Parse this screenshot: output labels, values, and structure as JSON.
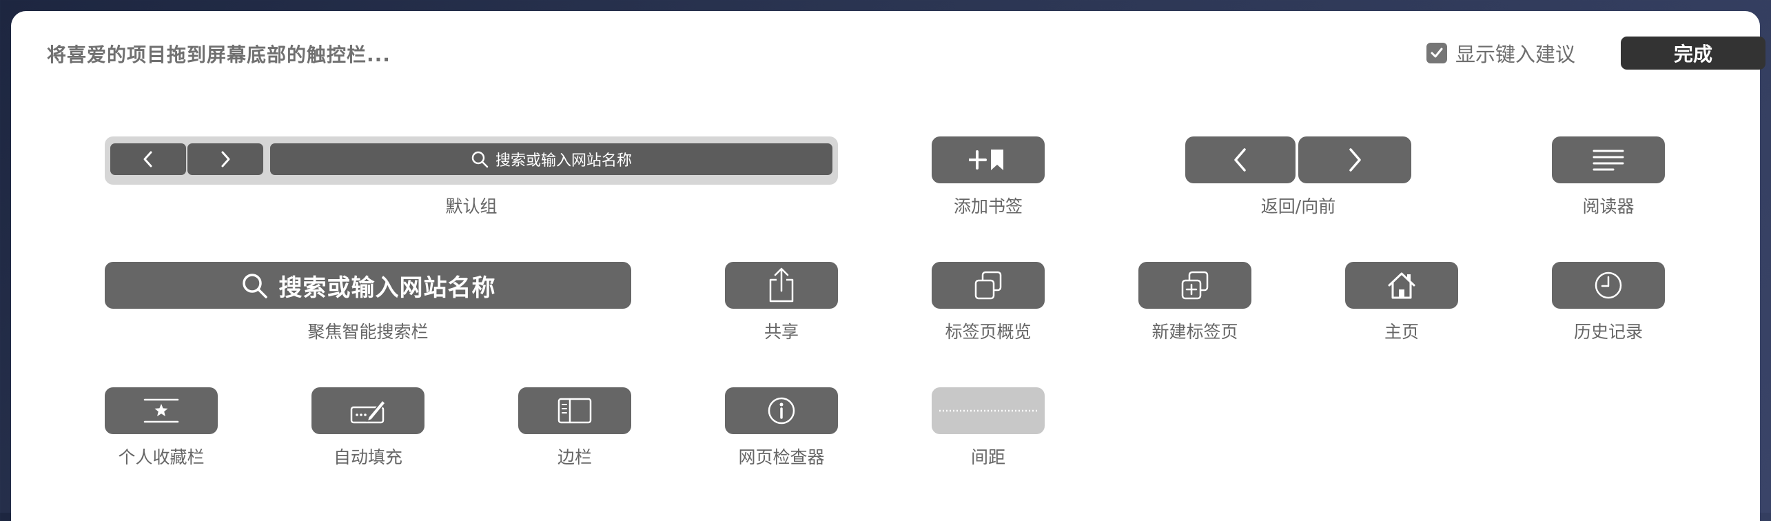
{
  "header": {
    "instruction": "将喜爱的项目拖到屏幕底部的触控栏...",
    "suggest_label": "显示键入建议",
    "suggest_checked": true,
    "done_label": "完成"
  },
  "items": {
    "default_group": {
      "label": "默认组",
      "search_text": "搜索或输入网站名称"
    },
    "add_bookmark": {
      "label": "添加书签",
      "icon": "add-bookmark-icon"
    },
    "back_forward": {
      "label": "返回/向前",
      "icon": "chevron-icon"
    },
    "reader": {
      "label": "阅读器",
      "icon": "reader-icon"
    },
    "smart_search": {
      "label": "聚焦智能搜索栏",
      "search_text": "搜索或输入网站名称"
    },
    "share": {
      "label": "共享",
      "icon": "share-icon"
    },
    "tab_overview": {
      "label": "标签页概览",
      "icon": "tab-overview-icon"
    },
    "new_tab": {
      "label": "新建标签页",
      "icon": "new-tab-icon"
    },
    "home": {
      "label": "主页",
      "icon": "home-icon"
    },
    "history": {
      "label": "历史记录",
      "icon": "clock-icon"
    },
    "favorites_bar": {
      "label": "个人收藏栏",
      "icon": "favorites-bar-icon"
    },
    "autofill": {
      "label": "自动填充",
      "icon": "autofill-icon"
    },
    "sidebar": {
      "label": "边栏",
      "icon": "sidebar-icon"
    },
    "web_inspector": {
      "label": "网页检查器",
      "icon": "info-icon"
    },
    "spacer": {
      "label": "间距",
      "icon": "spacer-icon"
    }
  },
  "colors": {
    "button": "#666666",
    "label": "#666666",
    "spacer_button": "#c8c8c8",
    "done_button": "#333333"
  }
}
